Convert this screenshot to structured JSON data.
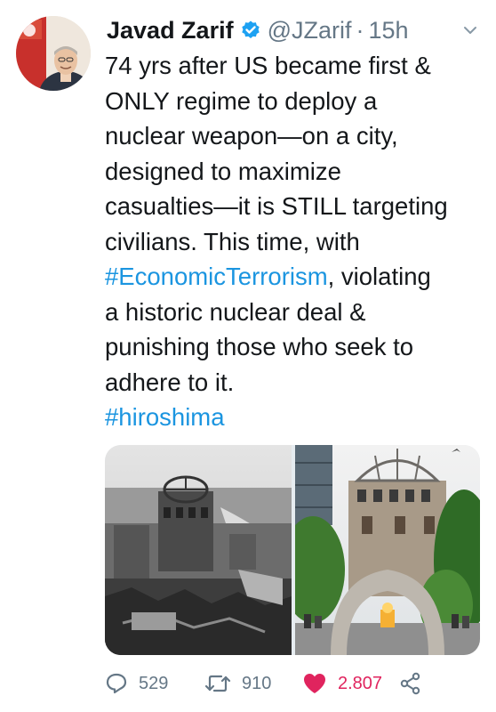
{
  "tweet": {
    "author_name": "Javad Zarif",
    "handle": "@JZarif",
    "separator": "·",
    "time": "15h",
    "lines": [
      "74 yrs after US became first &",
      "ONLY regime to deploy a",
      "nuclear weapon—on a city,",
      "designed to maximize",
      "casualties—it is STILL targeting",
      "civilians. This time, with"
    ],
    "hashtag1": "#EconomicTerrorism",
    "line7_rest": ", violating",
    "lines_after": [
      "a historic nuclear deal &",
      "punishing those who seek to",
      "adhere to it."
    ],
    "hashtag2": "#hiroshima"
  },
  "actions": {
    "replies": "529",
    "retweets": "910",
    "likes": "2.807"
  },
  "colors": {
    "link": "#1b95e0",
    "like": "#e0245e",
    "muted": "#657786",
    "verified": "#1da1f2"
  }
}
